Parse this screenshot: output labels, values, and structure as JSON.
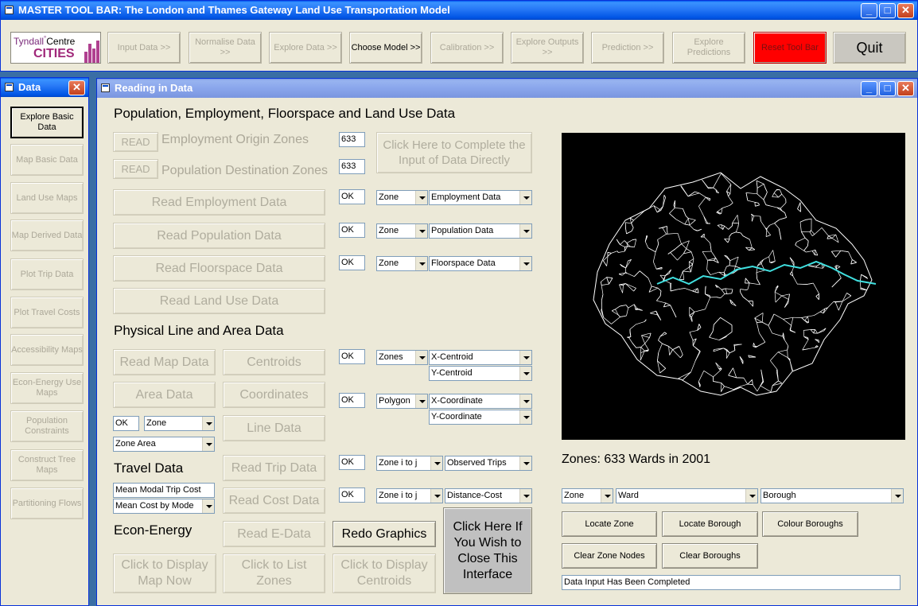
{
  "toolbar_window": {
    "title": "MASTER TOOL BAR: The London and Thames Gateway Land Use Transportation Model",
    "logo_line1": "Tyndall",
    "logo_sup": "°",
    "logo_line1b": "Centre",
    "logo_line2": "CITIES",
    "buttons": [
      "Input Data >>",
      "Normalise Data >>",
      "Explore Data >>",
      "Choose Model >>",
      "Calibration >>",
      "Explore Outputs >>",
      "Prediction >>",
      "Explore Predictions",
      "Reset Tool Bar",
      "Quit"
    ],
    "reset_color": "#ff0000"
  },
  "data_window": {
    "title": "Data",
    "items": [
      "Explore Basic Data",
      "Map Basic Data",
      "Land Use Maps",
      "Map Derived Data",
      "Plot Trip Data",
      "Plot Travel Costs",
      "Accessibility Maps",
      "Econ-Energy Use Maps",
      "Population Constraints",
      "Construct Tree Maps",
      "Partitioning Flows"
    ]
  },
  "reading_window": {
    "title": "Reading in Data",
    "heading_pop": "Population, Employment, Floorspace and Land Use Data",
    "read1": "READ",
    "read1_label": "Employment Origin Zones",
    "read1_value": "633",
    "read2": "READ",
    "read2_label": "Population Destination Zones",
    "read2_value": "633",
    "complete_btn": "Click Here to Complete the Input of Data Directly",
    "read_employment": "Read Employment Data",
    "read_population": "Read Population Data",
    "read_floorspace": "Read Floorspace Data",
    "read_landuse": "Read Land Use Data",
    "ok": "OK",
    "zone": "Zone",
    "zones": "Zones",
    "polygon": "Polygon",
    "employment_data": "Employment Data",
    "population_data": "Population Data",
    "floorspace_data": "Floorspace Data",
    "heading_physical": "Physical Line and Area Data",
    "read_map": "Read Map Data",
    "centroids": "Centroids",
    "area_data": "Area Data",
    "coordinates": "Coordinates",
    "line_data": "Line Data",
    "x_centroid": "X-Centroid",
    "y_centroid": "Y-Centroid",
    "x_coordinate": "X-Coordinate",
    "y_coordinate": "Y-Coordinate",
    "zone_area": "Zone Area",
    "heading_travel": "Travel Data",
    "read_trip": "Read Trip Data",
    "mean_modal": "Mean Modal Trip Cost",
    "mean_cost_mode": "Mean Cost by Mode",
    "read_cost": "Read Cost Data",
    "zone_ij": "Zone i to j",
    "observed_trips": "Observed Trips",
    "distance_cost": "Distance-Cost",
    "heading_econ": "Econ-Energy",
    "read_edata": "Read E-Data",
    "redo_graphics": "Redo Graphics",
    "close_interface": "Click Here If You Wish to Close This Interface",
    "display_map": "Click to Display Map Now",
    "list_zones": "Click to List Zones",
    "display_centroids": "Click to Display Centroids",
    "map_caption": "Zones: 633 Wards in 2001",
    "combo_zone": "Zone",
    "combo_ward": "Ward",
    "combo_borough": "Borough",
    "locate_zone": "Locate Zone",
    "locate_borough": "Locate Borough",
    "colour_boroughs": "Colour Boroughs",
    "clear_zone_nodes": "Clear Zone Nodes",
    "clear_boroughs": "Clear Boroughs",
    "status": "Data Input Has Been Completed",
    "river_color": "#40e0e0"
  }
}
